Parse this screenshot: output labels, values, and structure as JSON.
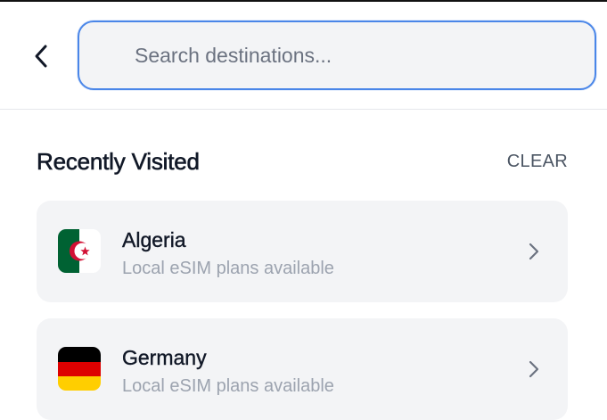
{
  "header": {
    "back_icon": "chevron-left-icon",
    "search": {
      "placeholder": "Search destinations...",
      "value": ""
    }
  },
  "recent": {
    "title": "Recently Visited",
    "clear_label": "CLEAR",
    "items": [
      {
        "name": "Algeria",
        "subtitle": "Local eSIM plans available",
        "flag_icon": "algeria-flag-icon"
      },
      {
        "name": "Germany",
        "subtitle": "Local eSIM plans available",
        "flag_icon": "germany-flag-icon"
      }
    ]
  },
  "colors": {
    "accent": "#4a86e8",
    "card_bg": "#f3f4f6",
    "muted_text": "#9ca3af"
  }
}
